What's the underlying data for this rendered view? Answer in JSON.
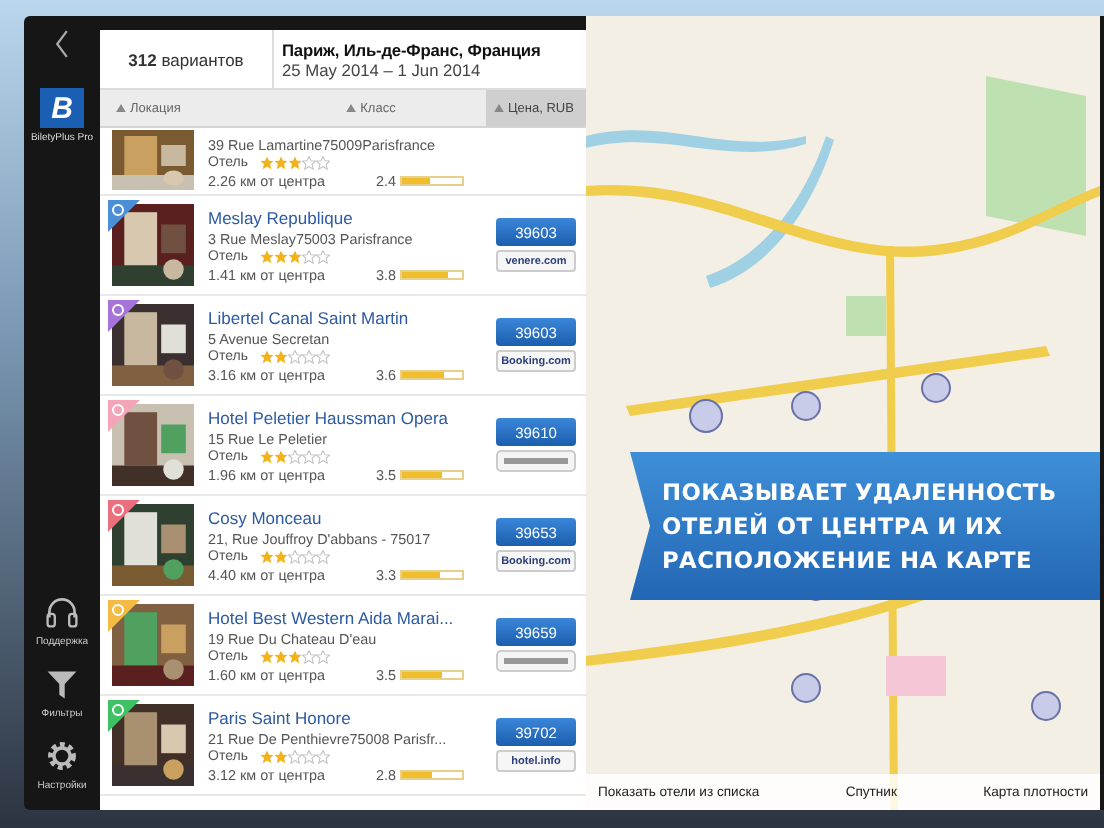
{
  "sidebar": {
    "app_name": "BiletyPlus Pro",
    "logo": "B",
    "items": [
      {
        "kind": "support",
        "label": "Поддержка"
      },
      {
        "kind": "filter",
        "label": "Фильтры"
      },
      {
        "kind": "settings",
        "label": "Настройки"
      }
    ]
  },
  "header": {
    "count": "**312** вариантов",
    "city": "Париж, Иль-де-Франс, Франция",
    "dates": "25 May 2014  –  1 Jun 2014"
  },
  "sort_tabs": [
    {
      "label": "Локация",
      "selected": false
    },
    {
      "label": "Класс",
      "selected": false
    },
    {
      "label": "Цена, RUB",
      "selected": true
    }
  ],
  "hotels": [
    {
      "address": "39 Rue Lamartine75009Parisfrance",
      "class": "Отель",
      "stars": 3,
      "distance": "2.26 км от центра",
      "rating": "2.4",
      "level": 0.45
    },
    {
      "name": "Meslay Republique",
      "address": "3 Rue Meslay75003 Parisfrance",
      "class": "Отель",
      "stars": 3,
      "distance": "1.41 км от центра",
      "rating": "3.8",
      "level": 0.75,
      "price": "39603",
      "provider": "venere.com",
      "color": "#4a8fd8"
    },
    {
      "name": "Libertel Canal Saint Martin",
      "address": "5 Avenue Secretan",
      "class": "Отель",
      "stars": 2,
      "distance": "3.16 км от центра",
      "rating": "3.6",
      "level": 0.7,
      "price": "39603",
      "provider": "Booking.com",
      "color": "#a674d8"
    },
    {
      "name": "Hotel Peletier Haussman Opera",
      "address": "15 Rue Le Peletier",
      "class": "Отель",
      "stars": 2,
      "distance": "1.96 км от центра",
      "rating": "3.5",
      "level": 0.68,
      "price": "39610",
      "color": "#f4a6b8"
    },
    {
      "name": "Cosy Monceau",
      "address": "21, Rue Jouffroy D'abbans - 75017",
      "class": "Отель",
      "stars": 2,
      "distance": "4.40 км от центра",
      "rating": "3.3",
      "level": 0.64,
      "price": "39653",
      "provider": "Booking.com",
      "color": "#ec6f7e"
    },
    {
      "name": "Hotel Best Western Aida Marai...",
      "address": "19 Rue Du Chateau D'eau",
      "class": "Отель",
      "stars": 3,
      "distance": "1.60 км от центра",
      "rating": "3.5",
      "level": 0.68,
      "price": "39659",
      "color": "#f4bb44"
    },
    {
      "name": "Paris Saint Honore",
      "address": "21 Rue De Penthievre75008 Parisfr...",
      "class": "Отель",
      "stars": 2,
      "distance": "3.12 км от центра",
      "rating": "2.8",
      "level": 0.5,
      "price": "39702",
      "provider": "hotel.info",
      "color": "#3fc264"
    }
  ],
  "map": {
    "banner": [
      "ПОКАЗЫВАЕТ УДАЛЕННОСТЬ",
      "ОТЕЛЕЙ ОТ ЦЕНТРА И ИХ",
      "РАСПОЛОЖЕНИЕ НА КАРТЕ"
    ],
    "buttons": [
      "Показать отели из списка",
      "Спутник",
      "Карта плотности"
    ]
  }
}
